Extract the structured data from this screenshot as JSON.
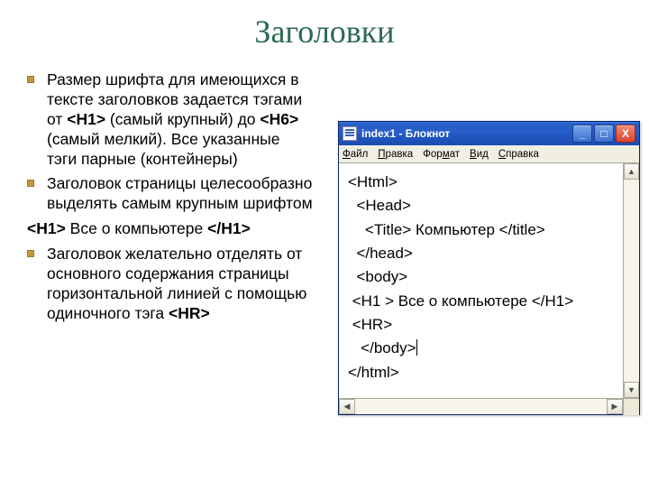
{
  "title": "Заголовки",
  "bullets": {
    "b1_pre": "Размер шрифта для имеющихся в тексте заголовков задается тэгами от ",
    "b1_h1": "<H1>",
    "b1_mid": " (самый крупный) до ",
    "b1_h6": "<H6>",
    "b1_post": " (самый мелкий). Все указанные тэги парные (контейнеры)",
    "b2": "Заголовок страницы целесообразно выделять самым крупным шрифтом",
    "code_open": "<H1>",
    "code_text": " Все о компьютере ",
    "code_close": "</H1>",
    "b3_pre": "Заголовок желательно отделять от основного содержания страницы горизонтальной линией с помощью одиночного тэга ",
    "b3_hr": "<HR>"
  },
  "notepad": {
    "window_title": "index1 - Блокнот",
    "menu": {
      "file": "Файл",
      "edit": "Правка",
      "format": "Формат",
      "view": "Вид",
      "help": "Справка"
    },
    "lines": {
      "l1": "<Html>",
      "l2": "  <Head>",
      "l3": "    <Title> Компьютер </title>",
      "l4": "  </head>",
      "l5": "  <body>",
      "l6": " <H1 > Все о компьютере </H1>",
      "l7": " <HR>",
      "l8": "   </body>",
      "l9": "</html>"
    },
    "btn_min": "_",
    "btn_max": "□",
    "btn_close": "X",
    "arrow_up": "▲",
    "arrow_down": "▼",
    "arrow_left": "◀",
    "arrow_right": "▶"
  }
}
